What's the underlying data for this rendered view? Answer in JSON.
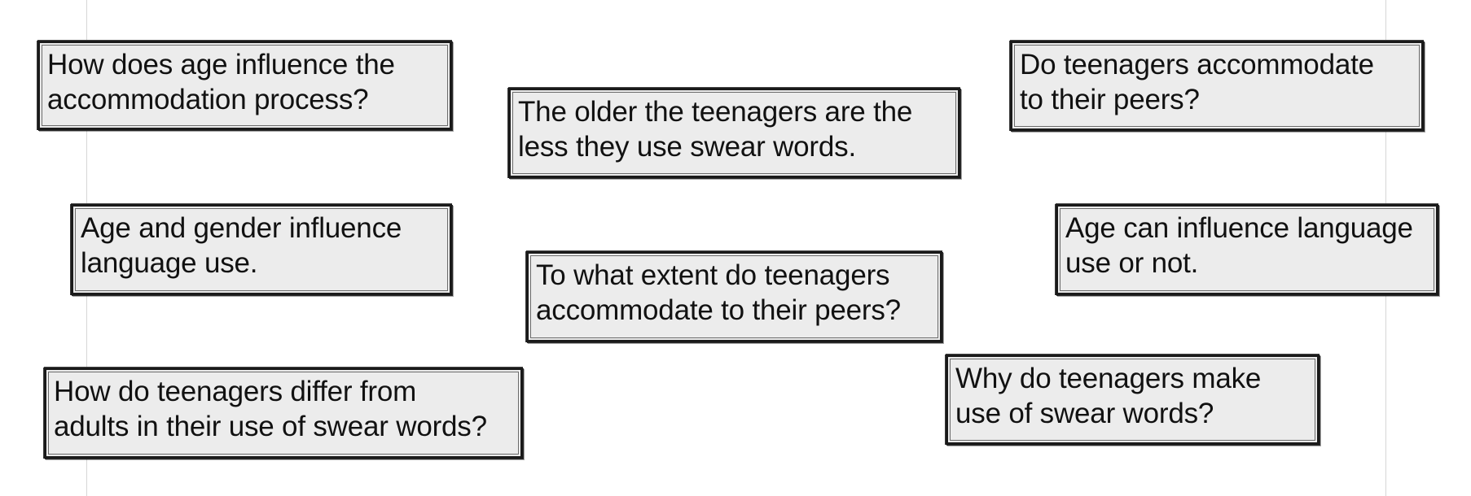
{
  "cards": [
    {
      "text": "How does age influence the\naccommodation process?"
    },
    {
      "text": "The older the teenagers are the\nless they use swear words."
    },
    {
      "text": "Do teenagers accommodate\nto their peers?"
    },
    {
      "text": "Age and gender influence\nlanguage use."
    },
    {
      "text": "To what extent do teenagers\naccommodate to their peers?"
    },
    {
      "text": "Age can influence language\nuse or not."
    },
    {
      "text": "How do teenagers differ from\nadults in their use of swear words?"
    },
    {
      "text": "Why do teenagers make\nuse of swear words?"
    }
  ]
}
